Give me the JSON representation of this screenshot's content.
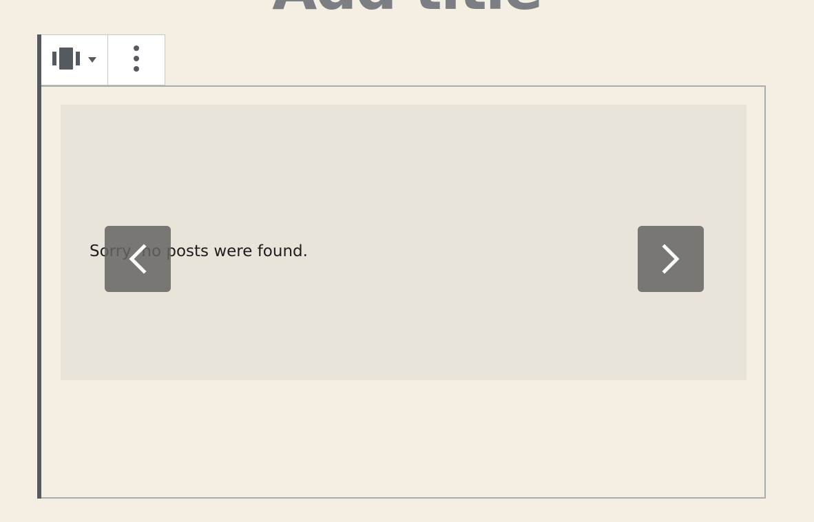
{
  "post": {
    "title": "Add title"
  },
  "toolbar": {
    "switcher_icon": "carousel-block-icon",
    "dropdown_icon": "caret-down-icon",
    "more_icon": "more-vertical-icon"
  },
  "slider": {
    "empty_message": "Sorry, no posts were found.",
    "prev_icon": "chevron-left-icon",
    "next_icon": "chevron-right-icon"
  },
  "colors": {
    "page_background": "#f5eee3",
    "slider_background": "#e8e4d9",
    "arrow_background": "#6e6e6a",
    "accent_bar": "#555a60"
  }
}
